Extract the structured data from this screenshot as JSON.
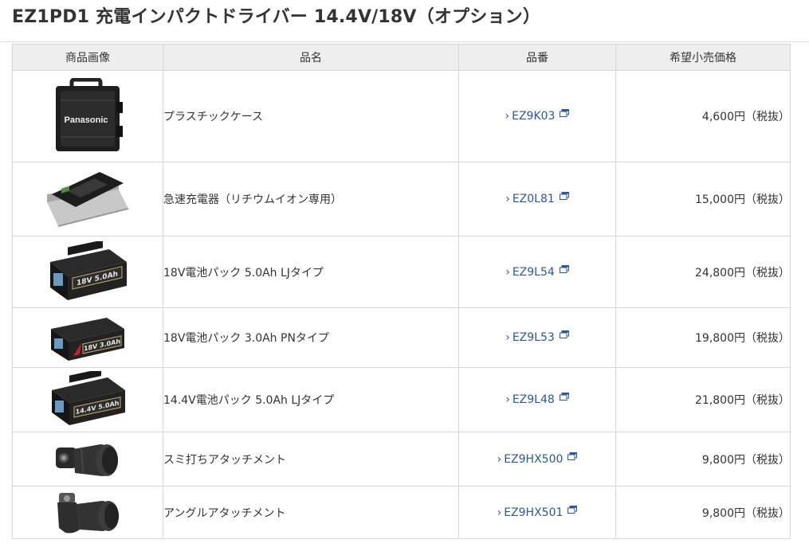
{
  "page": {
    "title": "EZ1PD1 充電インパクトドライバー 14.4V/18V（オプション）"
  },
  "table": {
    "headers": [
      "商品画像",
      "品名",
      "品番",
      "希望小売価格"
    ],
    "rows": [
      {
        "name": "プラスチックケース",
        "code": "EZ9K03",
        "price": "4,600円（税抜）",
        "image_icon": "plastic-case-image",
        "image_text": "Panasonic"
      },
      {
        "name": "急速充電器（リチウムイオン専用）",
        "code": "EZ0L81",
        "price": "15,000円（税抜）",
        "image_icon": "charger-image"
      },
      {
        "name": "18V電池パック 5.0Ah LJタイプ",
        "code": "EZ9L54",
        "price": "24,800円（税抜）",
        "image_icon": "battery-pack-image",
        "image_text": "18V 5.0Ah"
      },
      {
        "name": "18V電池パック 3.0Ah PNタイプ",
        "code": "EZ9L53",
        "price": "19,800円（税抜）",
        "image_icon": "battery-pack-image",
        "image_text": "18V 3.0Ah"
      },
      {
        "name": "14.4V電池パック 5.0Ah LJタイプ",
        "code": "EZ9L48",
        "price": "21,800円（税抜）",
        "image_icon": "battery-pack-image",
        "image_text": "14.4V 5.0Ah"
      },
      {
        "name": "スミ打ちアタッチメント",
        "code": "EZ9HX500",
        "price": "9,800円（税抜）",
        "image_icon": "corner-attachment-image"
      },
      {
        "name": "アングルアタッチメント",
        "code": "EZ9HX501",
        "price": "9,800円（税抜）",
        "image_icon": "angle-attachment-image"
      }
    ]
  },
  "colors": {
    "link": "#2a56a8",
    "header_bg": "#eeeeee",
    "border": "#d6d6d6",
    "text": "#333333"
  }
}
